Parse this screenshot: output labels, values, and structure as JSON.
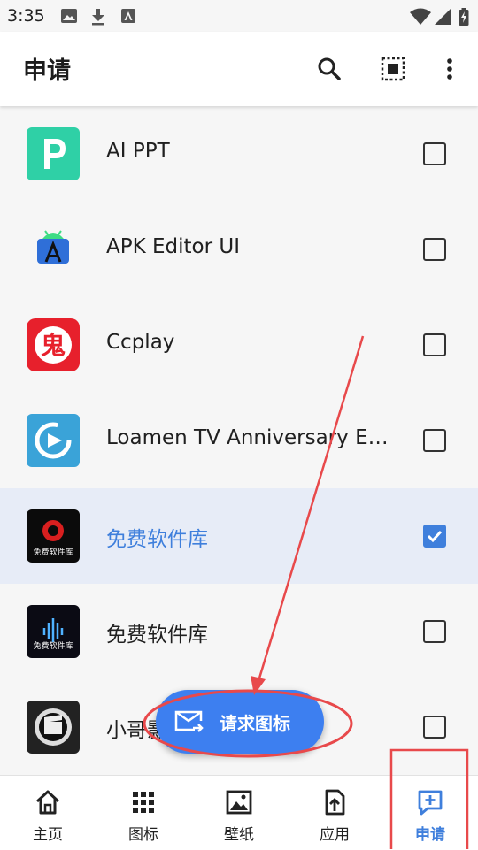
{
  "status_bar": {
    "time": "3:35"
  },
  "app_bar": {
    "title": "申请"
  },
  "apps": [
    {
      "name": "AI PPT",
      "checked": false
    },
    {
      "name": "APK Editor UI",
      "checked": false
    },
    {
      "name": "Ccplay",
      "checked": false
    },
    {
      "name": "Loamen TV Anniversary Ed...",
      "checked": false
    },
    {
      "name": "免费软件库",
      "checked": true
    },
    {
      "name": "免费软件库",
      "checked": false
    },
    {
      "name": "小哥影",
      "checked": false
    }
  ],
  "icon_text": {
    "ccplay_glyph": "鬼",
    "mfrjk_caption": "免费软件库"
  },
  "fab": {
    "label": "请求图标"
  },
  "bottom_nav": [
    {
      "label": "主页"
    },
    {
      "label": "图标"
    },
    {
      "label": "壁纸"
    },
    {
      "label": "应用"
    },
    {
      "label": "申请"
    }
  ],
  "colors": {
    "accent": "#3f7fdc",
    "fab": "#3d7ff0",
    "annotation": "#e8494b"
  }
}
